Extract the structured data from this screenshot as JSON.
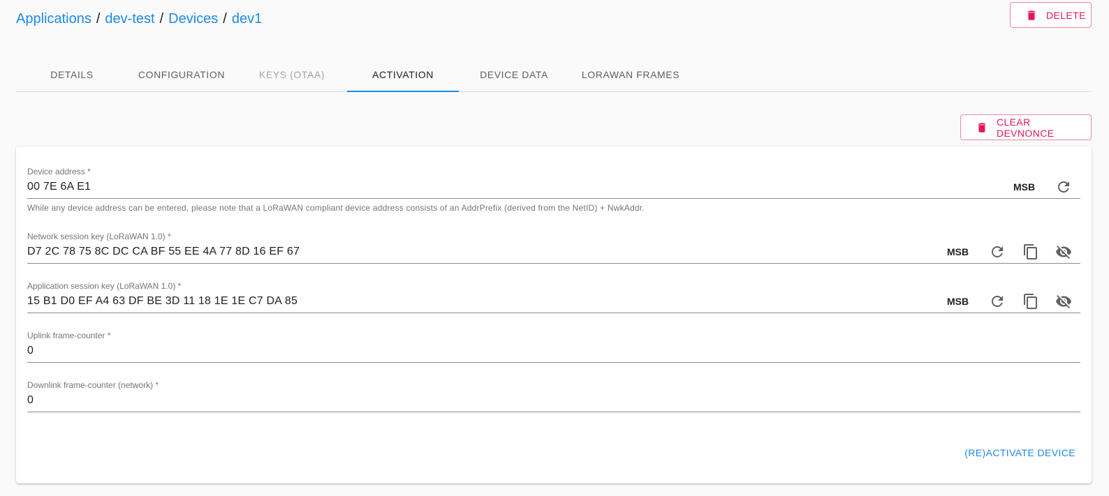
{
  "breadcrumb": {
    "items": [
      "Applications",
      "dev-test",
      "Devices",
      "dev1"
    ],
    "separator": "/"
  },
  "actions": {
    "delete_label": "DELETE",
    "clear_devnonce_label": "CLEAR DEVNONCE"
  },
  "tabs": [
    {
      "label": "DETAILS",
      "state": "normal"
    },
    {
      "label": "CONFIGURATION",
      "state": "normal"
    },
    {
      "label": "KEYS (OTAA)",
      "state": "disabled"
    },
    {
      "label": "ACTIVATION",
      "state": "active"
    },
    {
      "label": "DEVICE DATA",
      "state": "normal"
    },
    {
      "label": "LORAWAN FRAMES",
      "state": "normal"
    }
  ],
  "form": {
    "device_address": {
      "label": "Device address *",
      "value": "00 7E 6A E1",
      "byte_order": "MSB",
      "helper": "While any device address can be entered, please note that a LoRaWAN compliant device address consists of an AddrPrefix (derived from the NetID) + NwkAddr."
    },
    "nwk_s_key": {
      "label": "Network session key (LoRaWAN 1.0) *",
      "value": "D7 2C 78 75 8C DC CA BF 55 EE 4A 77 8D 16 EF 67",
      "byte_order": "MSB"
    },
    "app_s_key": {
      "label": "Application session key (LoRaWAN 1.0) *",
      "value": "15 B1 D0 EF A4 63 DF BE 3D 11 18 1E 1E C7 DA 85",
      "byte_order": "MSB"
    },
    "f_cnt_up": {
      "label": "Uplink frame-counter *",
      "value": "0"
    },
    "n_f_cnt_down": {
      "label": "Downlink frame-counter (network) *",
      "value": "0"
    },
    "submit_label": "(RE)ACTIVATE DEVICE"
  },
  "icons": {
    "delete": "trash-icon",
    "refresh": "refresh-icon",
    "copy": "copy-icon",
    "visibility": "eye-off-icon"
  },
  "colors": {
    "link": "#1e88e5",
    "danger": "#e5165e",
    "tab_indicator": "#1e88e5"
  }
}
